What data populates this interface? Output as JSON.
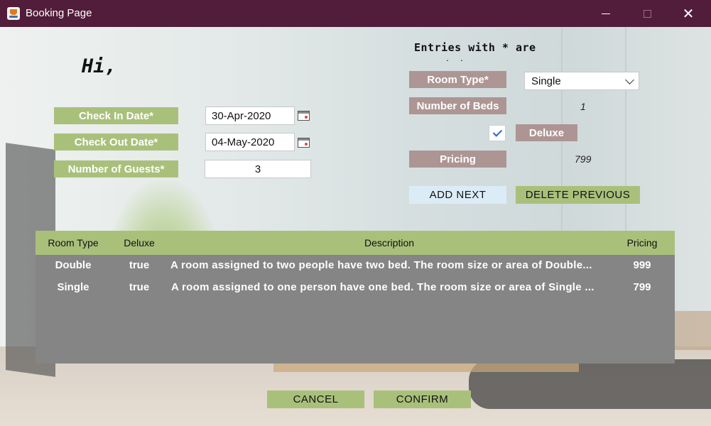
{
  "window": {
    "title": "Booking Page"
  },
  "greeting": "Hi,",
  "form": {
    "check_in_label": "Check In Date*",
    "check_in_value": "30-Apr-2020",
    "check_out_label": "Check Out Date*",
    "check_out_value": "04-May-2020",
    "guests_label": "Number of Guests*",
    "guests_value": "3"
  },
  "room": {
    "notice_text": "Entries with * are",
    "notice_dots": ". .",
    "room_type_label": "Room Type*",
    "room_type_selected": "Single",
    "beds_label": "Number of Beds",
    "beds_value": "1",
    "deluxe_checked": true,
    "deluxe_label": "Deluxe",
    "pricing_label": "Pricing",
    "pricing_value": "799",
    "add_next_label": "ADD NEXT",
    "delete_previous_label": "DELETE PREVIOUS"
  },
  "table": {
    "headers": [
      "Room Type",
      "Deluxe",
      "Description",
      "Pricing"
    ],
    "rows": [
      [
        "Double",
        "true",
        "A room assigned to two people have two bed. The room size or area of Double...",
        "999"
      ],
      [
        "Single",
        "true",
        "A room assigned to one person have one bed. The room size or area of Single ...",
        "799"
      ]
    ]
  },
  "footer": {
    "cancel_label": "CANCEL",
    "confirm_label": "CONFIRM"
  },
  "colors": {
    "titlebar": "#511d3a",
    "green_label": "#a9c07b",
    "mauve_label": "#ad9594",
    "table_body": "#858585",
    "add_next_bg": "#dcecf6"
  },
  "icons": {
    "app": "java-cup-icon",
    "calendar": "calendar-icon",
    "minimize": "minimize-icon",
    "maximize": "maximize-icon",
    "close": "close-icon",
    "dropdown": "chevron-down-icon",
    "checkbox": "checkmark-icon"
  }
}
